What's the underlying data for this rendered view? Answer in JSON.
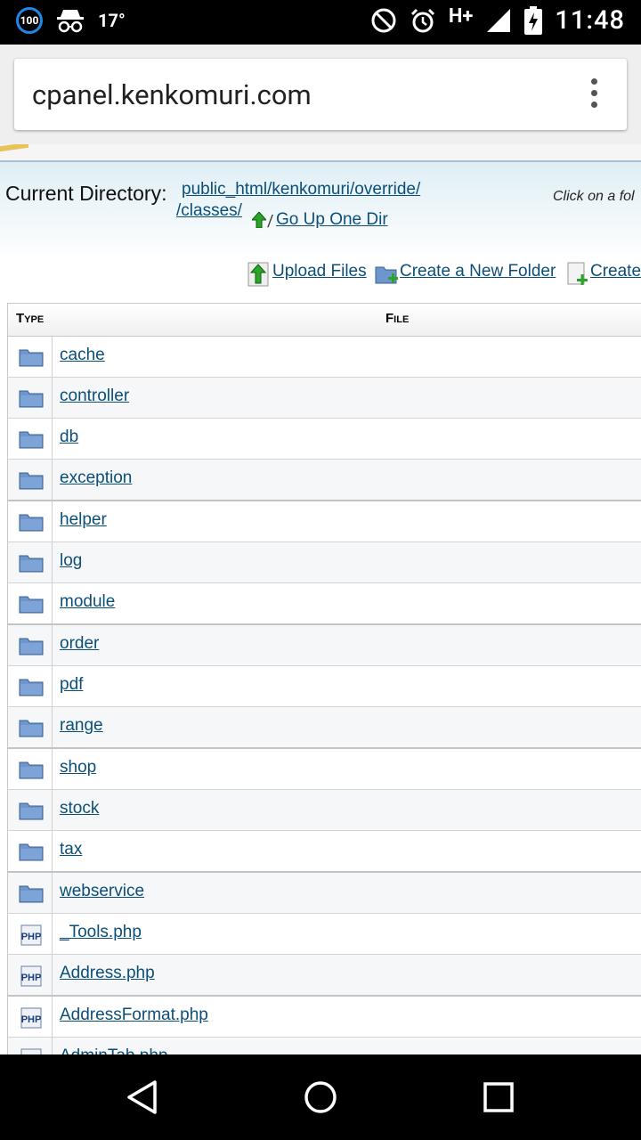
{
  "status_bar": {
    "badge": "100",
    "temperature": "17°",
    "network": "H+",
    "time": "11:48"
  },
  "browser": {
    "url": "cpanel.kenkomuri.com"
  },
  "page": {
    "current_directory_label": "Current Directory:",
    "path_line1": "public_html/kenkomuri/override/",
    "path_line2": "/classes/",
    "path_slash": "/",
    "go_up": "Go Up One Dir",
    "click_hint": "Click on a fol",
    "actions": {
      "upload": "Upload Files",
      "new_folder": "Create a New Folder",
      "create": "Create"
    },
    "table": {
      "col_type": "Type",
      "col_file": "File",
      "rows": [
        {
          "kind": "folder",
          "name": "cache"
        },
        {
          "kind": "folder",
          "name": "controller"
        },
        {
          "kind": "folder",
          "name": "db"
        },
        {
          "kind": "folder",
          "name": "exception"
        },
        {
          "kind": "folder",
          "name": "helper"
        },
        {
          "kind": "folder",
          "name": "log"
        },
        {
          "kind": "folder",
          "name": "module"
        },
        {
          "kind": "folder",
          "name": "order"
        },
        {
          "kind": "folder",
          "name": "pdf"
        },
        {
          "kind": "folder",
          "name": "range"
        },
        {
          "kind": "folder",
          "name": "shop"
        },
        {
          "kind": "folder",
          "name": "stock"
        },
        {
          "kind": "folder",
          "name": "tax"
        },
        {
          "kind": "folder",
          "name": "webservice"
        },
        {
          "kind": "php",
          "name": "_Tools.php"
        },
        {
          "kind": "php",
          "name": "Address.php"
        },
        {
          "kind": "php",
          "name": "AddressFormat.php"
        },
        {
          "kind": "php",
          "name": "AdminTab.php"
        }
      ]
    }
  },
  "icons": {
    "folder": "folder-icon",
    "php": "php-file-icon"
  }
}
